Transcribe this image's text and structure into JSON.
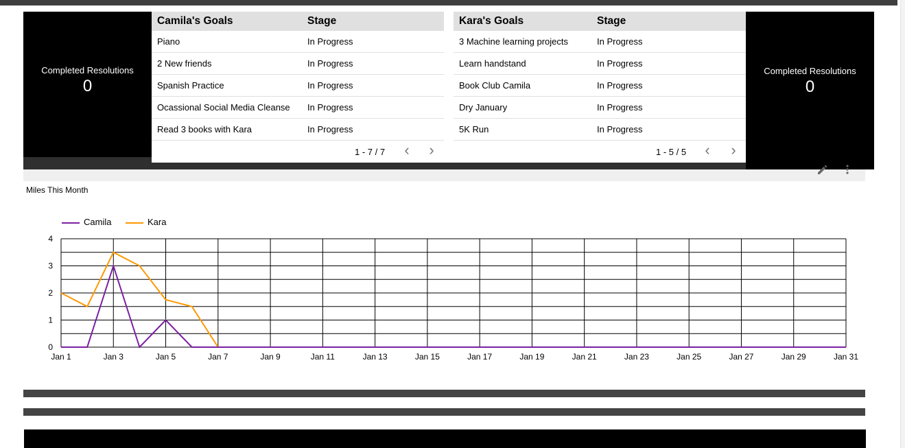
{
  "scorecards": {
    "left": {
      "label": "Completed Resolutions",
      "value": "0"
    },
    "right": {
      "label": "Completed Resolutions",
      "value": "0"
    }
  },
  "camila_table": {
    "headers": [
      "Camila's Goals",
      "Stage"
    ],
    "rows": [
      [
        "Piano",
        "In Progress"
      ],
      [
        "2 New friends",
        "In Progress"
      ],
      [
        "Spanish Practice",
        "In Progress"
      ],
      [
        "Ocassional Social Media Cleanse",
        "In Progress"
      ],
      [
        "Read 3 books with Kara",
        "In Progress"
      ]
    ],
    "pagination": "1 - 7 / 7"
  },
  "kara_table": {
    "headers": [
      "Kara's Goals",
      "Stage"
    ],
    "rows": [
      [
        "3 Machine learning projects",
        "In Progress"
      ],
      [
        "Learn handstand",
        "In Progress"
      ],
      [
        "Book Club Camila",
        "In Progress"
      ],
      [
        "Dry January",
        "In Progress"
      ],
      [
        "5K Run",
        "In Progress"
      ]
    ],
    "pagination": "1 - 5 / 5"
  },
  "icons": {
    "edit": "pencil-icon",
    "more": "kebab-menu-icon",
    "prev": "chevron-left-icon",
    "next": "chevron-right-icon"
  },
  "chart_data": {
    "type": "line",
    "title": "Miles This Month",
    "x": [
      "Jan 1",
      "Jan 2",
      "Jan 3",
      "Jan 4",
      "Jan 5",
      "Jan 6",
      "Jan 7",
      "Jan 8",
      "Jan 9",
      "Jan 10",
      "Jan 11",
      "Jan 12",
      "Jan 13",
      "Jan 14",
      "Jan 15",
      "Jan 16",
      "Jan 17",
      "Jan 18",
      "Jan 19",
      "Jan 20",
      "Jan 21",
      "Jan 22",
      "Jan 23",
      "Jan 24",
      "Jan 25",
      "Jan 26",
      "Jan 27",
      "Jan 28",
      "Jan 29",
      "Jan 30",
      "Jan 31"
    ],
    "xtick_labels": [
      "Jan 1",
      "Jan 3",
      "Jan 5",
      "Jan 7",
      "Jan 9",
      "Jan 11",
      "Jan 13",
      "Jan 15",
      "Jan 17",
      "Jan 19",
      "Jan 21",
      "Jan 23",
      "Jan 25",
      "Jan 27",
      "Jan 29",
      "Jan 31"
    ],
    "ytick_labels": [
      "0",
      "1",
      "2",
      "3",
      "4"
    ],
    "ylim": [
      0,
      4
    ],
    "grid": true,
    "legend_position": "top-left",
    "series": [
      {
        "name": "Camila",
        "color": "#7b1fa2",
        "values": [
          0,
          0,
          3,
          0,
          1,
          0,
          0,
          0,
          0,
          0,
          0,
          0,
          0,
          0,
          0,
          0,
          0,
          0,
          0,
          0,
          0,
          0,
          0,
          0,
          0,
          0,
          0,
          0,
          0,
          0,
          0
        ]
      },
      {
        "name": "Kara",
        "color": "#ff9800",
        "values": [
          2,
          1.5,
          3.5,
          3,
          1.75,
          1.5,
          0,
          0,
          0,
          0,
          0,
          0,
          0,
          0,
          0,
          0,
          0,
          0,
          0,
          0,
          0,
          0,
          0,
          0,
          0,
          0,
          0,
          0,
          0,
          0,
          0
        ]
      }
    ]
  }
}
